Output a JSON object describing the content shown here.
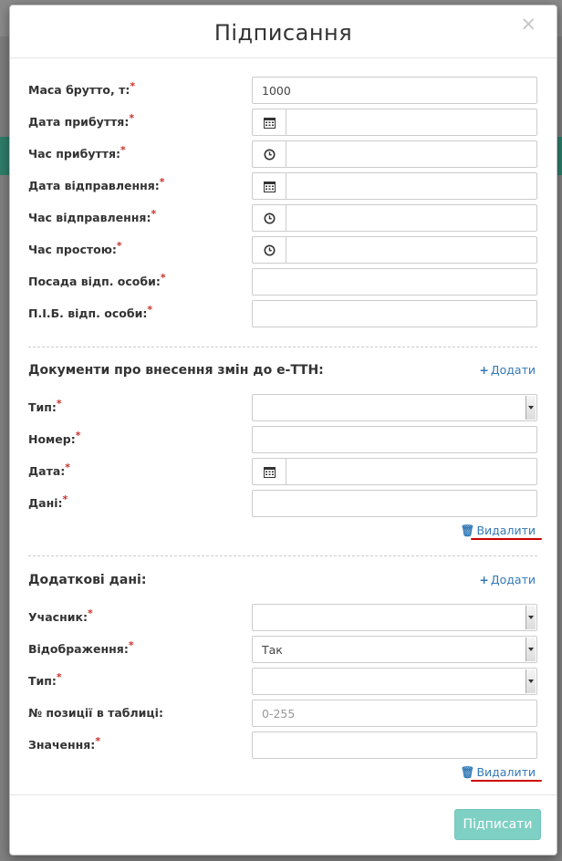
{
  "modal": {
    "title": "Підписання",
    "close_label": "×"
  },
  "main_fields": [
    {
      "label": "Маса брутто, т:",
      "value": "1000",
      "addon": ""
    },
    {
      "label": "Дата прибуття:",
      "value": "",
      "addon": "calendar-icon"
    },
    {
      "label": "Час прибуття:",
      "value": "",
      "addon": "clock-icon"
    },
    {
      "label": "Дата відправлення:",
      "value": "",
      "addon": "calendar-icon"
    },
    {
      "label": "Час відправлення:",
      "value": "",
      "addon": "clock-icon"
    },
    {
      "label": "Час простою:",
      "value": "",
      "addon": "clock-icon"
    },
    {
      "label": "Посада відп. особи:",
      "value": "",
      "addon": ""
    },
    {
      "label": "П.І.Б. відп. особи:",
      "value": "",
      "addon": ""
    }
  ],
  "documents_section": {
    "title": "Документи про внесення змін до е-ТТН:",
    "add_label": "Додати",
    "delete_label": "Видалити",
    "fields": [
      {
        "label": "Тип:",
        "value": "",
        "type": "select"
      },
      {
        "label": "Номер:",
        "value": ""
      },
      {
        "label": "Дата:",
        "value": "",
        "addon": "calendar-icon"
      },
      {
        "label": "Дані:",
        "value": ""
      }
    ]
  },
  "additional_section": {
    "title": "Додаткові дані:",
    "add_label": "Додати",
    "delete_label": "Видалити",
    "fields": [
      {
        "label": "Учасник:",
        "value": "",
        "type": "select"
      },
      {
        "label": "Відображення:",
        "value": "Так",
        "type": "select"
      },
      {
        "label": "Тип:",
        "value": "",
        "type": "select"
      },
      {
        "label": "№ позиції в таблиці:",
        "value": "",
        "placeholder": "0-255",
        "required": false
      },
      {
        "label": "Значення:",
        "value": ""
      }
    ]
  },
  "required_mark": "*",
  "footer": {
    "submit_label": "Підписати"
  },
  "colors": {
    "accent": "#7fd0c4",
    "link": "#337ab7",
    "required": "#c9302c",
    "highlight": "#cc0000"
  }
}
